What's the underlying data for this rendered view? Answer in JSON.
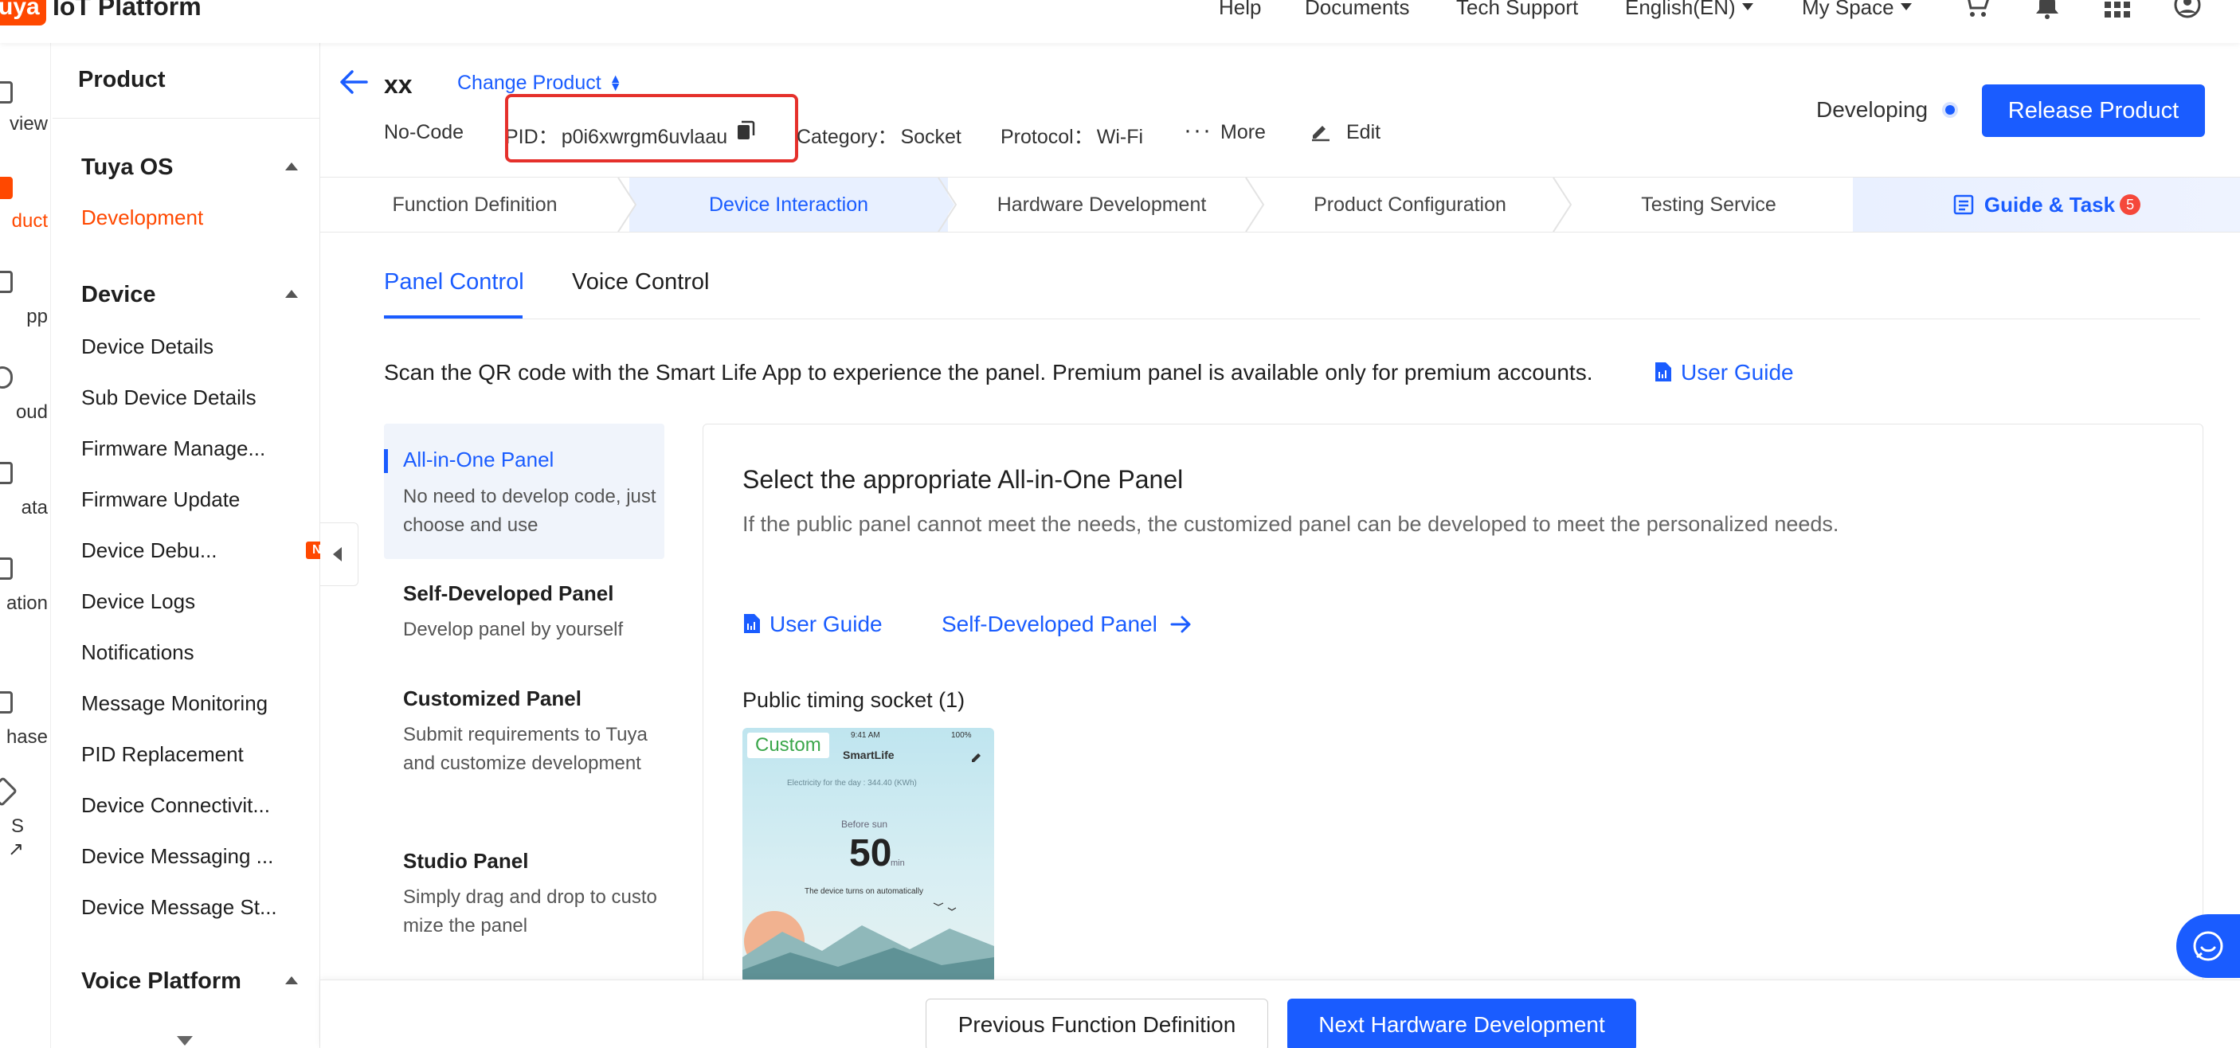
{
  "app": {
    "logo_badge": "uya",
    "logo_text": "IoT Platform"
  },
  "topnav": {
    "help": "Help",
    "documents": "Documents",
    "tech_support": "Tech Support",
    "language": "English(EN)",
    "my_space": "My Space"
  },
  "iconstrip": {
    "items": [
      "view",
      "duct",
      "pp",
      "oud",
      "ata",
      "ation",
      "hase",
      "S"
    ]
  },
  "sidebar": {
    "title": "Product",
    "groups": {
      "tuya_os": "Tuya OS",
      "device": "Device",
      "voice": "Voice Platform"
    },
    "tuya_os_items": [
      "Development"
    ],
    "device_items": [
      "Device Details",
      "Sub Device Details",
      "Firmware Manage...",
      "Firmware Update",
      "Device Debu...",
      "Device Logs",
      "Notifications",
      "Message Monitoring",
      "PID Replacement",
      "Device Connectivit...",
      "Device Messaging ...",
      "Device Message St..."
    ],
    "new_badge": "NEW"
  },
  "product": {
    "name": "xx",
    "change_label": "Change Product",
    "type": "No-Code",
    "pid_label": "PID：",
    "pid": "p0i6xwrgm6uvlaau",
    "category_label": "Category：",
    "category": "Socket",
    "protocol_label": "Protocol：",
    "protocol": "Wi-Fi",
    "more": "More",
    "edit": "Edit",
    "status": "Developing",
    "release": "Release Product"
  },
  "steps": [
    "Function Definition",
    "Device Interaction",
    "Hardware Development",
    "Product Configuration",
    "Testing Service"
  ],
  "guide": {
    "label": "Guide & Task",
    "badge": "5"
  },
  "subtabs": [
    "Panel Control",
    "Voice Control"
  ],
  "scan_text": "Scan the QR code with the Smart Life App to experience the panel. Premium panel is available only for premium accounts.",
  "user_guide": "User Guide",
  "panel_types": [
    {
      "title": "All-in-One Panel",
      "desc": "No need to develop code, just choose and use"
    },
    {
      "title": "Self-Developed Panel",
      "desc": "Develop panel by yourself"
    },
    {
      "title": "Customized Panel",
      "desc": "Submit requirements to Tuya and customize development"
    },
    {
      "title": "Studio Panel",
      "desc": "Simply drag and drop to customize the panel"
    }
  ],
  "card": {
    "title": "Select the appropriate All-in-One Panel",
    "desc": "If the public panel cannot meet the needs, the customized panel can be developed to meet the personalized needs.",
    "guide": "User Guide",
    "self_dev": "Self-Developed Panel",
    "section": "Public timing socket (1)"
  },
  "preview": {
    "badge": "Custom",
    "time": "9:41 AM",
    "battery": "100%",
    "app": "SmartLife",
    "electricity": "Electricity for the day : 344.40 (KWh)",
    "before": "Before sun",
    "minutes": "50",
    "unit": "min",
    "note": "The device turns on automatically"
  },
  "footer": {
    "prev": "Previous Function Definition",
    "next": "Next Hardware Development"
  },
  "colors": {
    "accent": "#1a5cff",
    "brand": "#ff4800",
    "highlight": "#e5302b"
  }
}
